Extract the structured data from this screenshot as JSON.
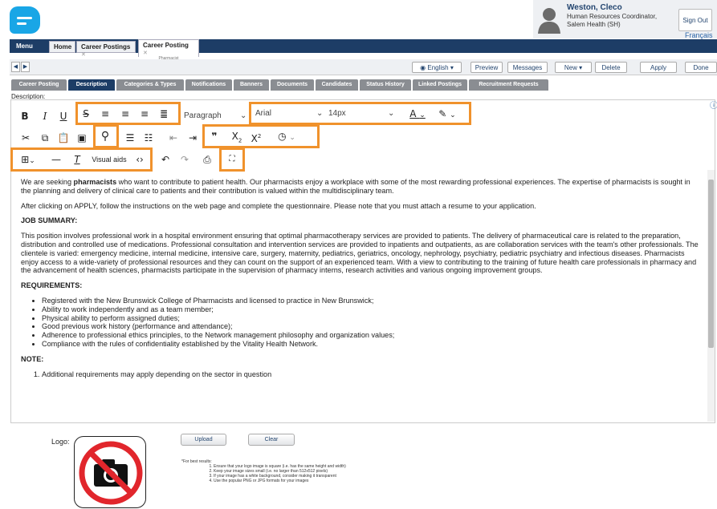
{
  "user": {
    "name": "Weston, Cleco",
    "role": "Human Resources Coordinator, Salem Health (SH)",
    "signout": "Sign Out",
    "language": "Français"
  },
  "nav": {
    "menu": "Menu",
    "home": "Home",
    "career_postings": "Career Postings",
    "career_posting": "Career Posting",
    "career_posting_sub": "Pharmacist"
  },
  "toolbar": {
    "language": "English",
    "preview": "Preview",
    "messages": "Messages",
    "new": "New",
    "delete": "Delete",
    "apply": "Apply",
    "done": "Done"
  },
  "subtabs": [
    "Career Posting",
    "Description",
    "Categories & Types",
    "Notifications",
    "Banners",
    "Documents",
    "Candidates",
    "Status History",
    "Linked Postings",
    "Recruitment Requests"
  ],
  "active_subtab": "Description",
  "editor": {
    "label": "Description:",
    "block_format": "Paragraph",
    "font_family": "Arial",
    "font_size": "14px",
    "visual_aids": "Visual aids",
    "content": {
      "p1_pre": "We are seeking ",
      "p1_bold": "pharmacists",
      "p1_post": " who want to contribute to patient health. Our pharmacists enjoy a workplace with some of the most rewarding professional experiences. The expertise of pharmacists is sought in the planning and delivery of clinical care to patients and their contribution is valued within the multidisciplinary team.",
      "p2": "After clicking on APPLY, follow the instructions on the web page and complete the questionnaire. Please note that you must attach a resume to your application.",
      "h_job": "JOB SUMMARY:",
      "p3": "This position involves professional work in a hospital environment ensuring that optimal pharmacotherapy services are provided to patients. The delivery of pharmaceutical care is related to the preparation, distribution and controlled use of medications. Professional consultation and intervention services are provided to inpatients and outpatients, as are collaboration services with the team's other professionals. The clientele is varied: emergency medicine, internal medicine, intensive care, surgery, maternity, pediatrics, geriatrics, oncology, nephrology, psychiatry, pediatric psychiatry and infectious diseases. Pharmacists enjoy access to a wide-variety of professional resources and they can count on the support of an experienced team. With a view to contributing to the training of future health care professionals in pharmacy and the advancement of health sciences, pharmacists participate in the supervision of pharmacy interns, research activities and various ongoing improvement groups.",
      "h_req": "REQUIREMENTS:",
      "requirements": [
        "Registered with the New Brunswick College of Pharmacists and licensed to practice in New Brunswick;",
        "Ability to work independently and as a team member;",
        "Physical ability to perform assigned duties;",
        "Good previous work history (performance and attendance);",
        "Adherence to professional ethics principles, to the Network management philosophy and organization values;",
        "Compliance with the rules of confidentiality established by the Vitality Health Network."
      ],
      "h_note": "NOTE:",
      "note1": "Additional requirements may apply depending on the sector in question"
    }
  },
  "logo_section": {
    "label": "Logo:",
    "upload": "Upload",
    "clear": "Clear",
    "tips_title": "*For best results:",
    "tips": [
      "Ensure that your logo image is square (i.e. has the same height and width)",
      "Keep your image sizes small (i.e. no larger than 512x512 pixels)",
      "If your image has a white background, consider making it transparent",
      "Use the popular PNG or JPG formats for your images"
    ]
  },
  "colors": {
    "accent": "#f0922c",
    "nav": "#1d3d66",
    "logo": "#19a6e6",
    "no_sign": "#e1262c"
  },
  "icons": [
    "bold-icon",
    "italic-icon",
    "underline-icon",
    "strikethrough-icon",
    "align-left-icon",
    "align-center-icon",
    "align-right-icon",
    "justify-icon",
    "text-color-icon",
    "highlight-icon",
    "cut-icon",
    "copy-icon",
    "paste-icon",
    "paste-word-icon",
    "search-replace-icon",
    "bullet-list-icon",
    "numbered-list-icon",
    "outdent-icon",
    "indent-icon",
    "blockquote-icon",
    "subscript-icon",
    "superscript-icon",
    "insert-time-icon",
    "table-icon",
    "horizontal-rule-icon",
    "clear-format-icon",
    "source-code-icon",
    "undo-icon",
    "redo-icon",
    "print-icon",
    "fullscreen-icon",
    "help-icon"
  ]
}
